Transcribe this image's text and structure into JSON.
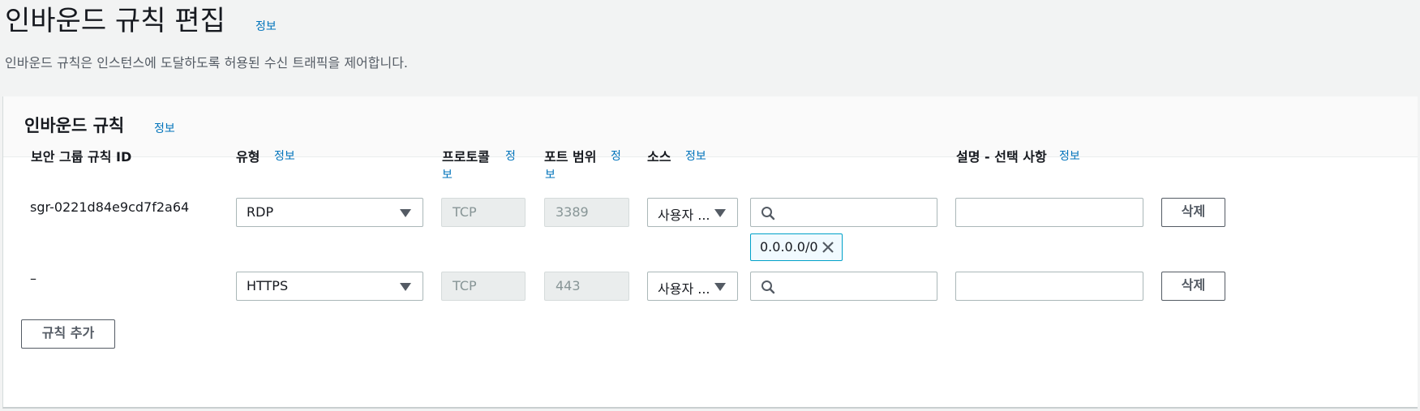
{
  "page": {
    "title": "인바운드 규칙 편집",
    "title_info": "정보",
    "description": "인바운드 규칙은 인스턴스에 도달하도록 허용된 수신 트래픽을 제어합니다."
  },
  "panel": {
    "title": "인바운드 규칙",
    "title_info": "정보"
  },
  "columns": {
    "rule_id": "보안 그룹 규칙 ID",
    "type": "유형",
    "type_info": "정보",
    "protocol_line1": "프로토콜",
    "protocol_info_line1": "정",
    "protocol_info_line2": "보",
    "port_range": "포트 범위",
    "port_info_line1": "정",
    "port_info_line2": "보",
    "source": "소스",
    "source_info": "정보",
    "description": "설명 - 선택 사항",
    "description_info": "정보"
  },
  "rows": [
    {
      "rule_id": "sgr-0221d84e9cd7f2a64",
      "type": "RDP",
      "protocol": "TCP",
      "port": "3389",
      "source_type": "사용자 ...",
      "source_search": "",
      "cidr_token": "0.0.0.0/0",
      "description": "",
      "delete_label": "삭제"
    },
    {
      "rule_id": "–",
      "type": "HTTPS",
      "protocol": "TCP",
      "port": "443",
      "source_type": "사용자 ...",
      "source_search": "",
      "description": "",
      "delete_label": "삭제"
    }
  ],
  "add_rule_label": "규칙 추가",
  "colors": {
    "page_bg": "#f2f3f3",
    "link": "#0073bb",
    "token_border": "#00a1c9",
    "token_bg": "#f1faff"
  }
}
